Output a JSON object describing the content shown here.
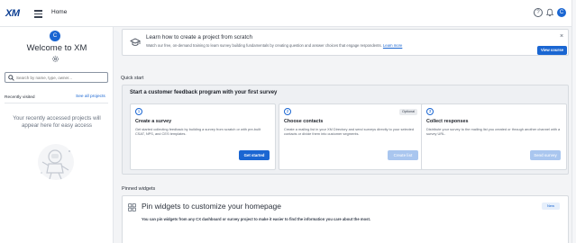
{
  "topbar": {
    "logo": "XM",
    "home_label": "Home",
    "help_icon": "help-icon",
    "notifications_icon": "bell-icon",
    "avatar_initial": "C"
  },
  "sidebar": {
    "avatar_initial": "C",
    "welcome": "Welcome to XM",
    "settings_icon": "gear-icon",
    "search_placeholder": "Search by name, type, owner...",
    "recent_label": "Recently visited",
    "see_all": "See all projects",
    "empty_text": "Your recently accessed projects will appear here for easy access"
  },
  "banner": {
    "title": "Learn how to create a project from scratch",
    "text": "Watch our free, on-demand training to learn survey building fundamentals by creating question and answer choices that engage respondents.",
    "link": "Learn more",
    "close_icon": "close-icon",
    "button": "View course"
  },
  "quick_start": {
    "label": "Quick start",
    "title": "Start a customer feedback program with your first survey",
    "cards": [
      {
        "number": "1",
        "title": "Create a survey",
        "description": "Get started collecting feedback by building a survey from scratch or with pre-built CSAT, NPS, and CES templates.",
        "button": "Get started",
        "enabled": true
      },
      {
        "number": "2",
        "title": "Choose contacts",
        "badge": "Optional",
        "description": "Create a mailing list in your XM Directory and send surveys directly to your selected contacts or divide them into customer segments.",
        "button": "Create list",
        "enabled": false
      },
      {
        "number": "3",
        "title": "Collect responses",
        "description": "Distribute your survey to the mailing list you created or through another channel with a survey URL.",
        "button": "Send survey",
        "enabled": false
      }
    ]
  },
  "pinned": {
    "label": "Pinned widgets",
    "title": "Pin widgets to customize your homepage",
    "badge": "New",
    "text": "You can pin widgets from any CX dashboard or survey project to make it easier to find the information you care about the most."
  },
  "colors": {
    "accent": "#1a66d2",
    "background": "#f3f4f6"
  }
}
